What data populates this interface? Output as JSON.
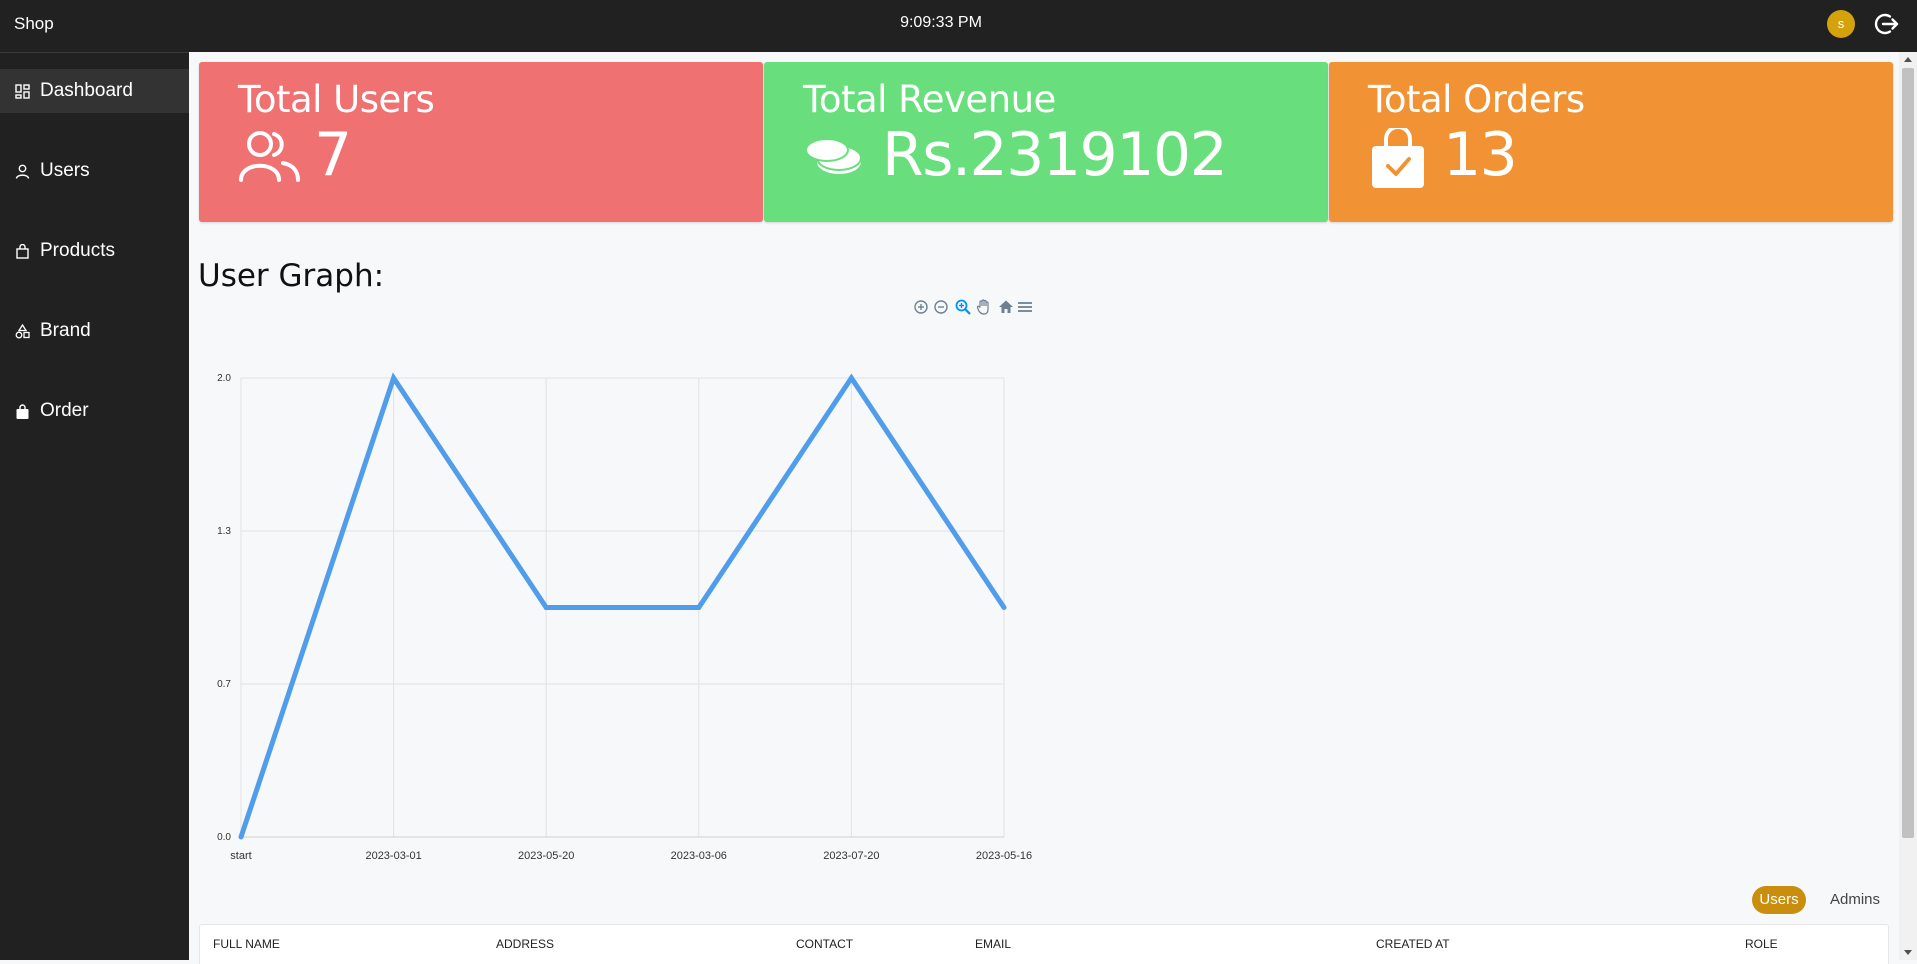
{
  "app": {
    "name": "Shop",
    "clock": "9:09:33 PM",
    "avatar_initial": "s"
  },
  "sidebar": {
    "items": [
      {
        "label": "Dashboard",
        "icon": "dashboard-icon",
        "active": true
      },
      {
        "label": "Users",
        "icon": "user-icon",
        "active": false
      },
      {
        "label": "Products",
        "icon": "bag-icon",
        "active": false
      },
      {
        "label": "Brand",
        "icon": "shapes-icon",
        "active": false
      },
      {
        "label": "Order",
        "icon": "shopping-bag-icon",
        "active": false
      }
    ]
  },
  "stats": [
    {
      "title": "Total Users",
      "value": "7",
      "icon": "users-icon",
      "color": "#ef7171"
    },
    {
      "title": "Total Revenue",
      "value": "Rs.2319102",
      "icon": "coins-icon",
      "color": "#68df7c"
    },
    {
      "title": "Total Orders",
      "value": "13",
      "icon": "shopping-bag-check-icon",
      "color": "#f19334"
    }
  ],
  "graph": {
    "title": "User Graph:",
    "toolbar": [
      "zoom-in-icon",
      "zoom-out-icon",
      "selection-zoom-icon",
      "pan-icon",
      "reset-home-icon",
      "menu-icon"
    ]
  },
  "chart_data": {
    "type": "line",
    "categories": [
      "start",
      "2023-03-01",
      "2023-05-20",
      "2023-03-06",
      "2023-07-20",
      "2023-05-16"
    ],
    "values": [
      0,
      2,
      1,
      1,
      2,
      1
    ],
    "yticks": [
      "0.0",
      "0.7",
      "1.3",
      "2.0"
    ],
    "ylim": [
      0,
      2
    ],
    "grid": true,
    "line_color": "#4f9deb"
  },
  "tabs": [
    {
      "label": "Users",
      "active": true
    },
    {
      "label": "Admins",
      "active": false
    }
  ],
  "table": {
    "columns": [
      "FULL NAME",
      "ADDRESS",
      "CONTACT",
      "EMAIL",
      "CREATED AT",
      "ROLE"
    ]
  },
  "colors": {
    "topbar": "#212121",
    "accent": "#c98e0e",
    "avatar": "#d4a20a"
  }
}
